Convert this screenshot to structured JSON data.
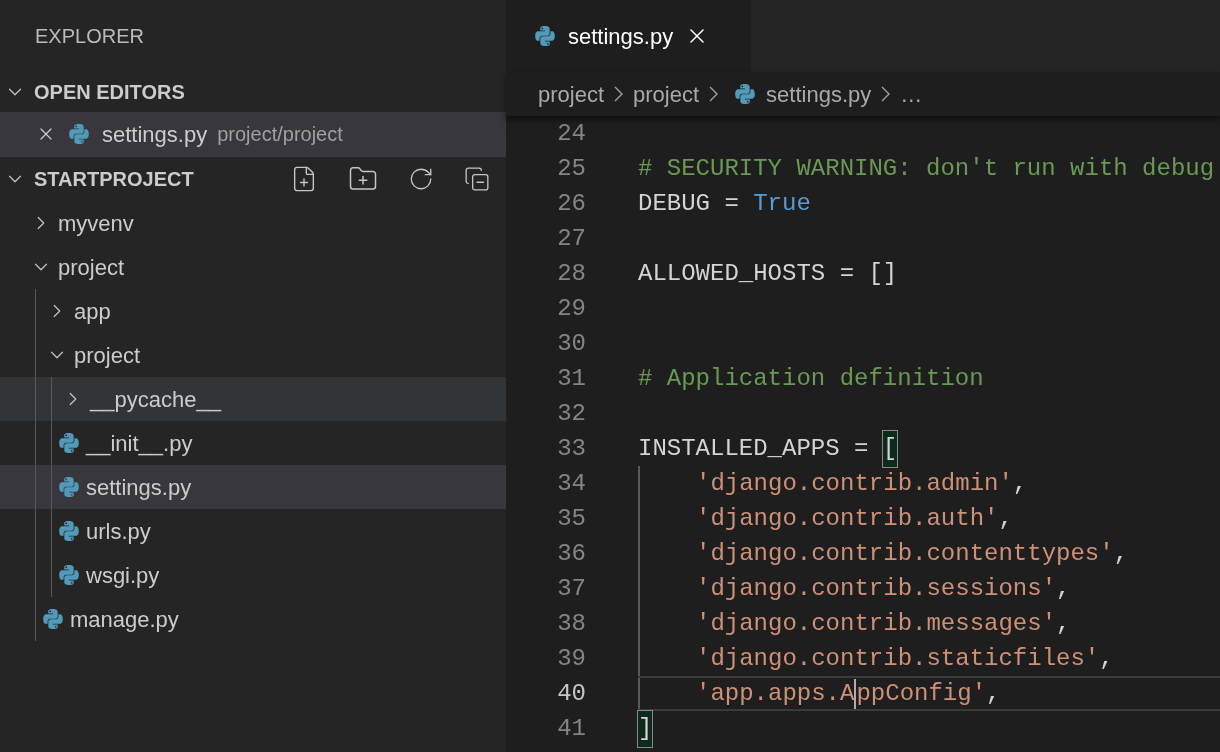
{
  "sidebar": {
    "title": "EXPLORER",
    "open_editors": {
      "title": "OPEN EDITORS",
      "expanded": true,
      "items": [
        {
          "label": "settings.py",
          "path": "project/project",
          "selected": true
        }
      ]
    },
    "project": {
      "title": "STARTPROJECT",
      "expanded": true,
      "tree": [
        {
          "label": "myvenv",
          "kind": "folder",
          "expanded": false,
          "selected": false,
          "hovered": false
        },
        {
          "label": "project",
          "kind": "folder",
          "expanded": true,
          "selected": false,
          "hovered": false,
          "children": [
            {
              "label": "app",
              "kind": "folder",
              "expanded": false,
              "selected": false,
              "hovered": false
            },
            {
              "label": "project",
              "kind": "folder",
              "expanded": true,
              "selected": false,
              "hovered": false,
              "children": [
                {
                  "label": "__pycache__",
                  "kind": "folder",
                  "expanded": false,
                  "selected": false,
                  "hovered": true
                },
                {
                  "label": "__init__.py",
                  "kind": "python",
                  "selected": false,
                  "hovered": false
                },
                {
                  "label": "settings.py",
                  "kind": "python",
                  "selected": true,
                  "hovered": false
                },
                {
                  "label": "urls.py",
                  "kind": "python",
                  "selected": false,
                  "hovered": false
                },
                {
                  "label": "wsgi.py",
                  "kind": "python",
                  "selected": false,
                  "hovered": false
                }
              ]
            },
            {
              "label": "manage.py",
              "kind": "python",
              "selected": false,
              "hovered": false
            }
          ]
        }
      ]
    }
  },
  "tabs": [
    {
      "label": "settings.py",
      "selected": true
    }
  ],
  "breadcrumbs": [
    {
      "label": "project",
      "kind": "folder"
    },
    {
      "label": "project",
      "kind": "folder"
    },
    {
      "label": "settings.py",
      "kind": "python"
    },
    {
      "label": "…",
      "kind": "symbol"
    }
  ],
  "code": [
    {
      "number": "24",
      "current": false,
      "guide": false
    },
    {
      "number": "25",
      "current": false,
      "guide": false,
      "tokens": [
        {
          "kind": "comment",
          "text": "# SECURITY WARNING: don't run with debug"
        }
      ]
    },
    {
      "number": "26",
      "current": false,
      "guide": false,
      "tokens": [
        {
          "kind": "plain",
          "text": "DEBUG = "
        },
        {
          "kind": "constant",
          "text": "True"
        }
      ]
    },
    {
      "number": "27",
      "current": false,
      "guide": false
    },
    {
      "number": "28",
      "current": false,
      "guide": false,
      "tokens": [
        {
          "kind": "plain",
          "text": "ALLOWED_HOSTS = []"
        }
      ]
    },
    {
      "number": "29",
      "current": false,
      "guide": false
    },
    {
      "number": "30",
      "current": false,
      "guide": false
    },
    {
      "number": "31",
      "current": false,
      "guide": false,
      "tokens": [
        {
          "kind": "comment",
          "text": "# Application definition"
        }
      ]
    },
    {
      "number": "32",
      "current": false,
      "guide": false
    },
    {
      "number": "33",
      "current": false,
      "guide": false,
      "tokens": [
        {
          "kind": "plain",
          "text": "INSTALLED_APPS = "
        },
        {
          "kind": "bracket_match",
          "text": "["
        }
      ]
    },
    {
      "number": "34",
      "current": false,
      "guide": true,
      "tokens": [
        {
          "kind": "string",
          "text": "'django.contrib.admin'"
        },
        {
          "kind": "plain",
          "text": ","
        }
      ]
    },
    {
      "number": "35",
      "current": false,
      "guide": true,
      "tokens": [
        {
          "kind": "string",
          "text": "'django.contrib.auth'"
        },
        {
          "kind": "plain",
          "text": ","
        }
      ]
    },
    {
      "number": "36",
      "current": false,
      "guide": true,
      "tokens": [
        {
          "kind": "string",
          "text": "'django.contrib.contenttypes'"
        },
        {
          "kind": "plain",
          "text": ","
        }
      ]
    },
    {
      "number": "37",
      "current": false,
      "guide": true,
      "tokens": [
        {
          "kind": "string",
          "text": "'django.contrib.sessions'"
        },
        {
          "kind": "plain",
          "text": ","
        }
      ]
    },
    {
      "number": "38",
      "current": false,
      "guide": true,
      "tokens": [
        {
          "kind": "string",
          "text": "'django.contrib.messages'"
        },
        {
          "kind": "plain",
          "text": ","
        }
      ]
    },
    {
      "number": "39",
      "current": false,
      "guide": true,
      "tokens": [
        {
          "kind": "string",
          "text": "'django.contrib.staticfiles'"
        },
        {
          "kind": "plain",
          "text": ","
        }
      ]
    },
    {
      "number": "40",
      "current": true,
      "guide": true,
      "tokens": [
        {
          "kind": "string",
          "text": "'app.apps.A"
        },
        {
          "kind": "cursor"
        },
        {
          "kind": "string",
          "text": "ppConfig'"
        },
        {
          "kind": "plain",
          "text": ","
        }
      ]
    },
    {
      "number": "41",
      "current": false,
      "guide": false,
      "tokens": [
        {
          "kind": "bracket_match",
          "text": "]"
        }
      ]
    }
  ]
}
